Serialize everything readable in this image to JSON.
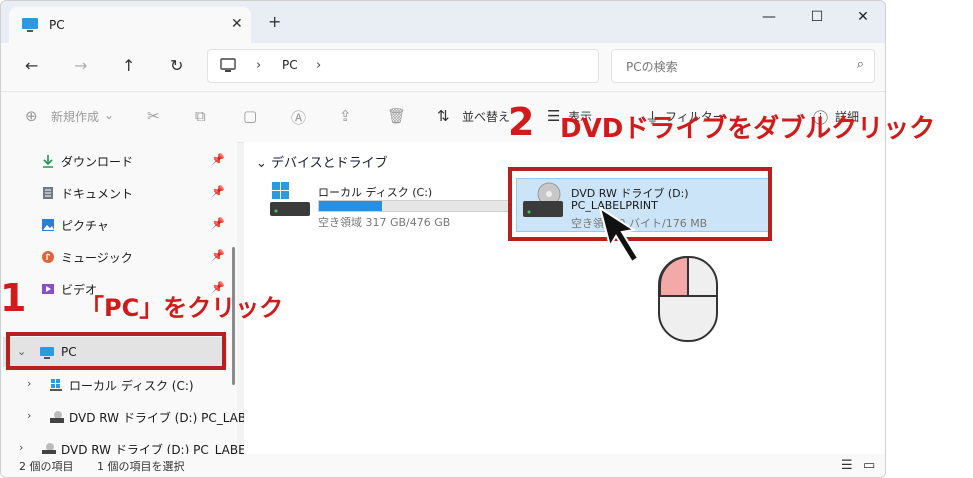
{
  "window": {
    "tab_title": "PC",
    "tab_close": "✕",
    "new_tab": "+",
    "controls": {
      "minimize": "—",
      "maximize": "☐",
      "close": "✕"
    }
  },
  "nav": {
    "back": "←",
    "forward": "→",
    "up": "↑",
    "refresh": "↻",
    "address_sep1": "›",
    "address_path": "PC",
    "address_sep2": "›",
    "search_placeholder": "PCの検索"
  },
  "command_bar": {
    "new_label": "新規作成",
    "sort_label": "並べ替え",
    "view_label": "表示",
    "filter_label": "フィルター",
    "details_label": "詳細"
  },
  "sidebar": {
    "items": [
      {
        "label": "ダウンロード",
        "icon": "download-icon"
      },
      {
        "label": "ドキュメント",
        "icon": "document-icon"
      },
      {
        "label": "ピクチャ",
        "icon": "pictures-icon"
      },
      {
        "label": "ミュージック",
        "icon": "music-icon"
      },
      {
        "label": "ビデオ",
        "icon": "video-icon"
      }
    ],
    "pc": "PC",
    "local_disk": "ローカル ディスク (C:)",
    "dvd_nested": "DVD RW ドライブ (D:) PC_LABEL",
    "dvd_root": "DVD RW ドライブ (D:) PC_LABELP"
  },
  "content": {
    "group_title": "デバイスとドライブ",
    "drives": [
      {
        "name": "ローカル ディスク (C:)",
        "space": "空き領域 317 GB/476 GB",
        "used_fraction": 0.33
      },
      {
        "name": "DVD RW ドライブ (D:)",
        "label": "PC_LABELPRINT",
        "space": "空き領域 0 バイト/176 MB"
      }
    ]
  },
  "status": {
    "count": "2 個の項目",
    "selected": "1 個の項目を選択"
  },
  "annotations": {
    "step1_num": "1",
    "step1_text": "「PC」をクリック",
    "step2_num": "2",
    "step2_text": "DVDドライブをダブルクリック",
    "color": "#d11a1a"
  }
}
